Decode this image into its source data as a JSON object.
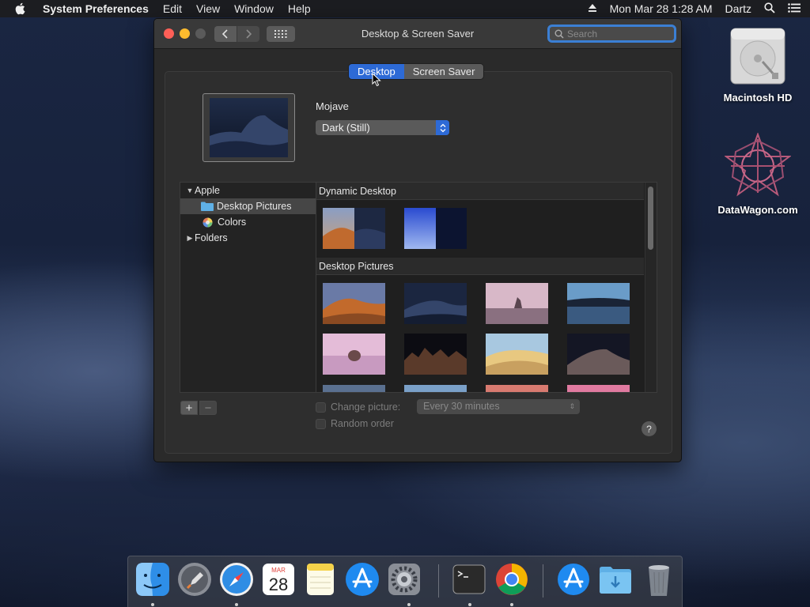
{
  "menubar": {
    "app_name": "System Preferences",
    "menus": [
      "Edit",
      "View",
      "Window",
      "Help"
    ],
    "datetime": "Mon Mar 28  1:28 AM",
    "user": "Dartz"
  },
  "window": {
    "title": "Desktop & Screen Saver",
    "search_placeholder": "Search",
    "tabs": [
      {
        "label": "Desktop",
        "active": true
      },
      {
        "label": "Screen Saver",
        "active": false
      }
    ],
    "picture_name": "Mojave",
    "style_value": "Dark (Still)",
    "source_list": {
      "apple": "Apple",
      "desktop_pictures": "Desktop Pictures",
      "colors": "Colors",
      "folders": "Folders"
    },
    "gallery": {
      "section_dynamic": "Dynamic Desktop",
      "section_pictures": "Desktop Pictures"
    },
    "change_picture_label": "Change picture:",
    "interval_value": "Every 30 minutes",
    "random_order_label": "Random order",
    "help": "?",
    "add": "+",
    "remove": "−"
  },
  "desktop_icons": [
    {
      "label": "Macintosh HD",
      "icon": "hard-drive-icon"
    },
    {
      "label": "DataWagon.com",
      "icon": "star-logo-icon"
    }
  ],
  "dock": {
    "calendar_month": "MAR",
    "calendar_day": "28",
    "items": [
      "finder-icon",
      "launchpad-icon",
      "safari-icon",
      "calendar-icon",
      "notes-icon",
      "app-store-icon",
      "system-preferences-icon",
      "terminal-icon",
      "chrome-icon",
      "app-store-icon",
      "downloads-folder-icon",
      "trash-icon"
    ]
  },
  "colors": {
    "accent": "#2d6ad6",
    "close": "#fe5f57",
    "minimize": "#febc2e"
  }
}
